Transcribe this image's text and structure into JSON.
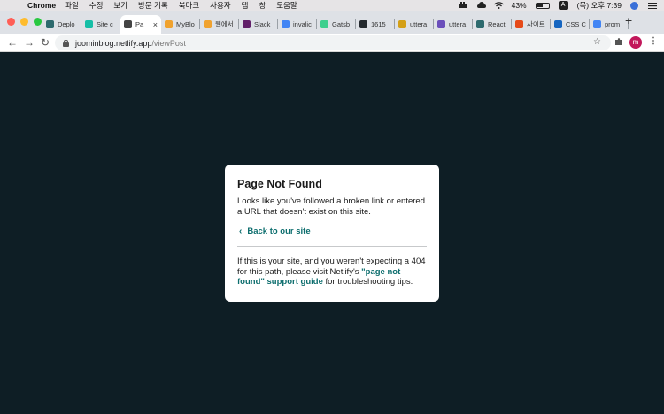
{
  "menubar": {
    "apple": "",
    "app": "Chrome",
    "items": [
      "파일",
      "수정",
      "보기",
      "방문 기록",
      "북마크",
      "사용자",
      "탭",
      "창",
      "도움말"
    ],
    "battery": "43%",
    "input_badge": "A",
    "clock": "(목) 오후 7:39"
  },
  "tabs": [
    {
      "label": "Deplo",
      "color": "#2d6a6e"
    },
    {
      "label": "Site c",
      "color": "#15bea6"
    },
    {
      "label": "Pa",
      "color": "#444444",
      "active": true
    },
    {
      "label": "MyBlo",
      "color": "#f0a22e"
    },
    {
      "label": "웹에서",
      "color": "#f0a22e"
    },
    {
      "label": "Slack",
      "color": "#611f69"
    },
    {
      "label": "invalic",
      "color": "#4285f4"
    },
    {
      "label": "Gatsb",
      "color": "#3ecf8e"
    },
    {
      "label": "1615",
      "color": "#24292e"
    },
    {
      "label": "uttera",
      "color": "#d4a017"
    },
    {
      "label": "uttera",
      "color": "#6b4fbb"
    },
    {
      "label": "React",
      "color": "#2d6a6e"
    },
    {
      "label": "사이트",
      "color": "#e64a19"
    },
    {
      "label": "CSS C",
      "color": "#1565c0"
    },
    {
      "label": "prom",
      "color": "#4285f4"
    }
  ],
  "toolbar": {
    "url_host": "joominblog.netlify.app",
    "url_path": "/viewPost",
    "avatar": "m"
  },
  "card": {
    "title": "Page Not Found",
    "message": "Looks like you've followed a broken link or entered a URL that doesn't exist on this site.",
    "back_link": "Back to our site",
    "help_before": "If this is your site, and you weren't expecting a 404 for this path, please visit Netlify's ",
    "help_link": "\"page not found\" support guide",
    "help_after": " for troubleshooting tips."
  }
}
